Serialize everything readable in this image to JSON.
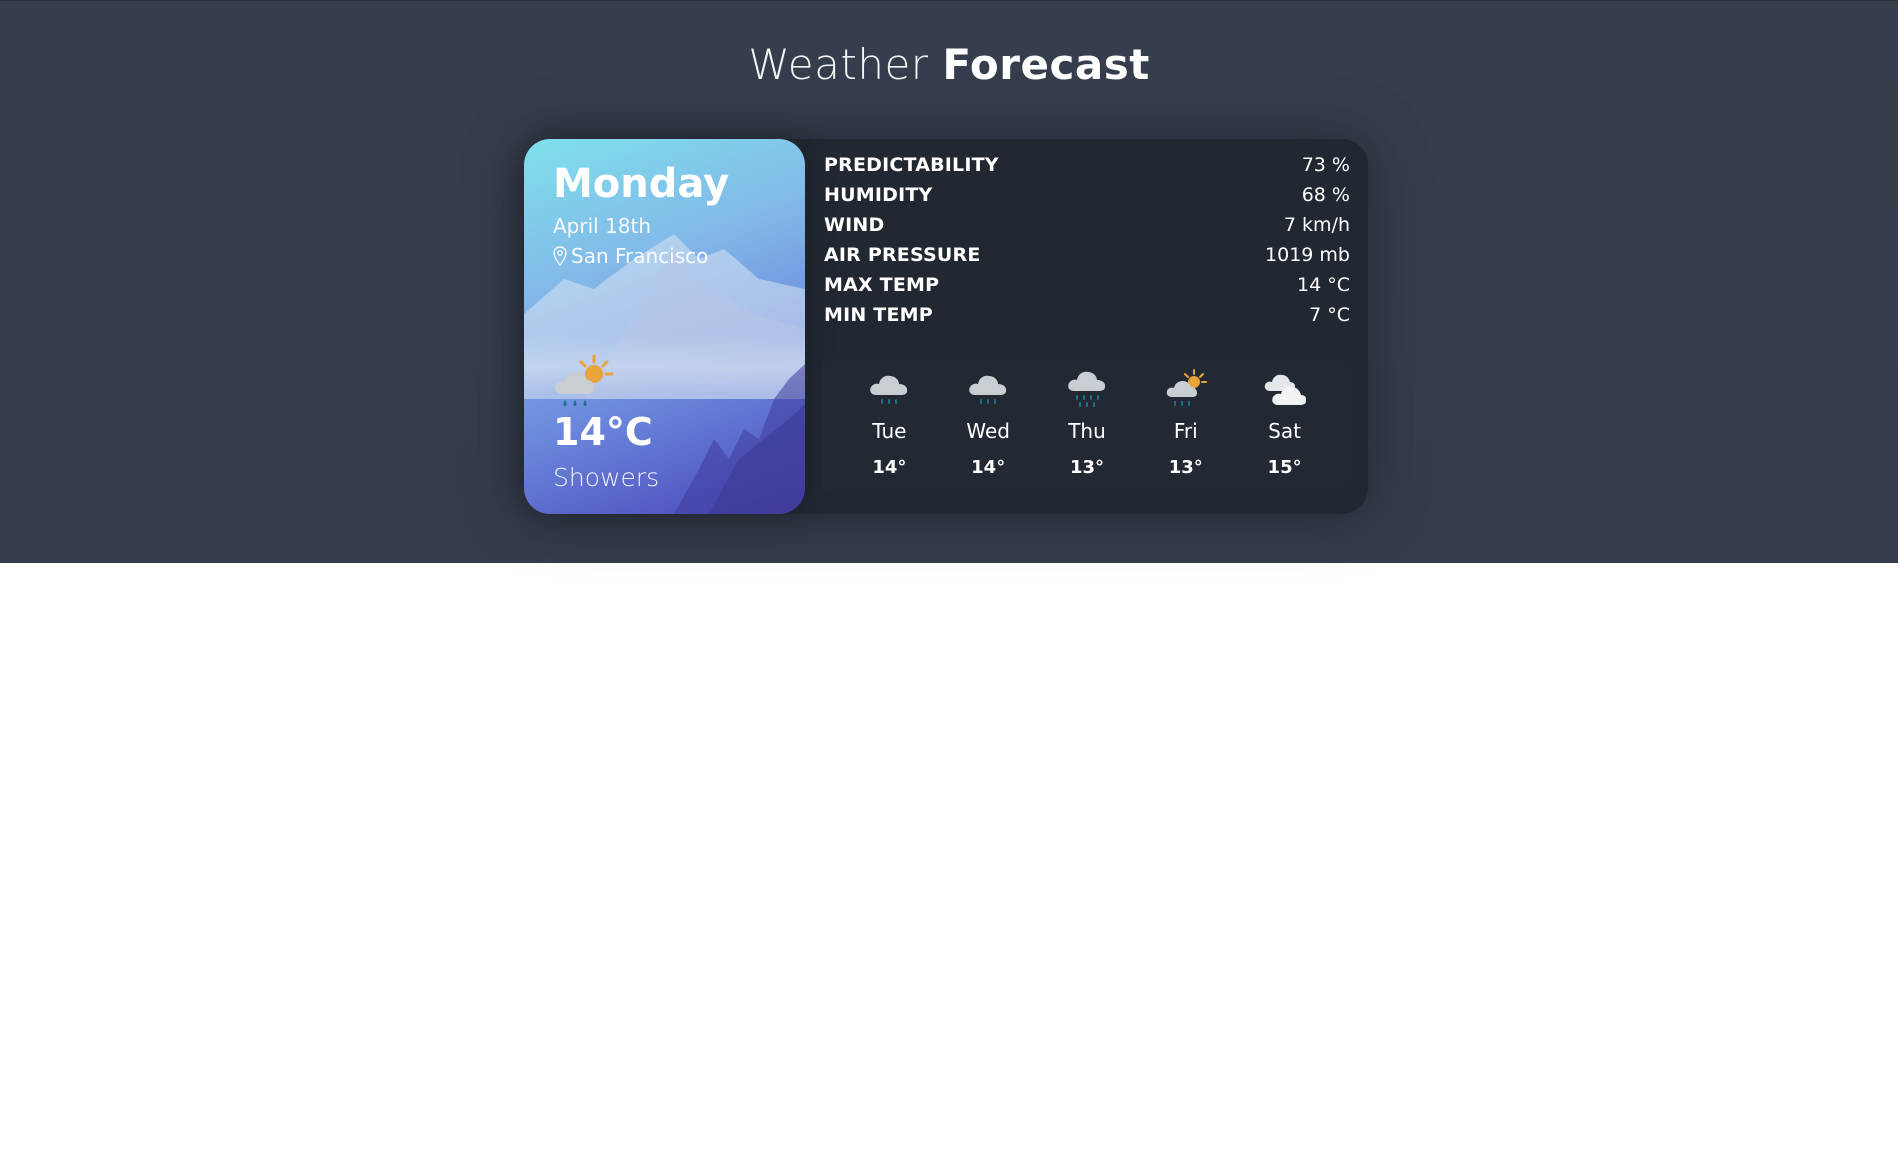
{
  "header": {
    "title_light": "Weather",
    "title_bold": "Forecast"
  },
  "today": {
    "day": "Monday",
    "date": "April 18th",
    "location": "San Francisco",
    "location_icon": "map-pin-icon",
    "icon": "cloud-rain-sun-icon",
    "temperature": "14°C",
    "condition": "Showers"
  },
  "stats": [
    {
      "label": "PREDICTABILITY",
      "value": "73 %"
    },
    {
      "label": "HUMIDITY",
      "value": "68 %"
    },
    {
      "label": "WIND",
      "value": "7 km/h"
    },
    {
      "label": "AIR PRESSURE",
      "value": "1019 mb"
    },
    {
      "label": "MAX TEMP",
      "value": "14 °C"
    },
    {
      "label": "MIN TEMP",
      "value": "7 °C"
    }
  ],
  "week": [
    {
      "day": "Tue",
      "temp": "14°",
      "icon": "cloud-light-rain-icon"
    },
    {
      "day": "Wed",
      "temp": "14°",
      "icon": "cloud-light-rain-icon"
    },
    {
      "day": "Thu",
      "temp": "13°",
      "icon": "cloud-heavy-rain-icon"
    },
    {
      "day": "Fri",
      "temp": "13°",
      "icon": "cloud-rain-sun-icon"
    },
    {
      "day": "Sat",
      "temp": "15°",
      "icon": "clouds-icon"
    }
  ],
  "colors": {
    "background": "#363e4d",
    "card": "#222831",
    "sun": "#e9a33b",
    "rain": "#1d6f8a",
    "cloud": "#c9ced3"
  }
}
